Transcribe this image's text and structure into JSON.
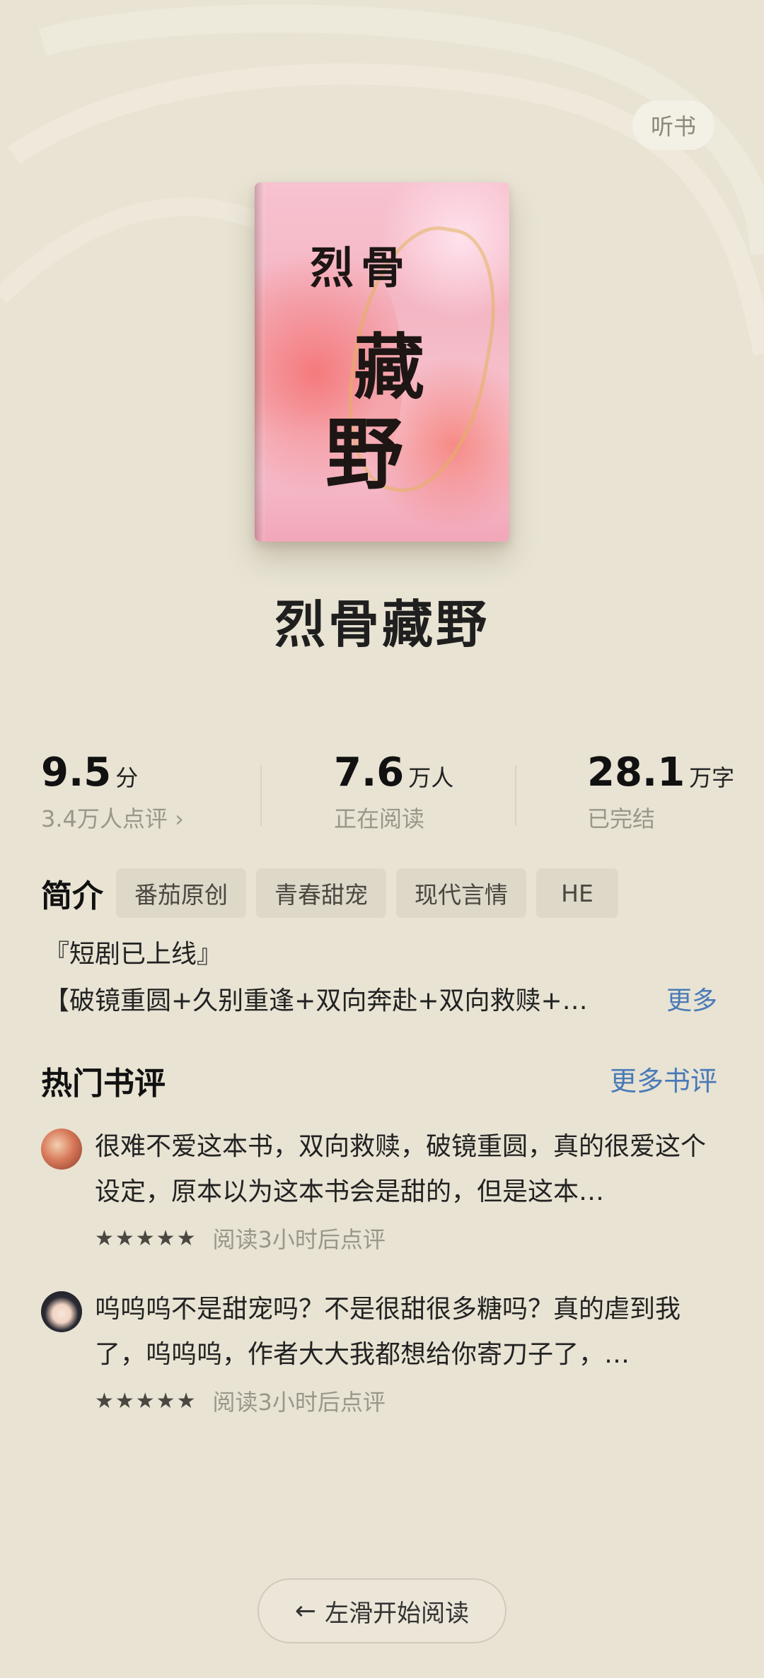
{
  "header": {
    "listen_label": "听书"
  },
  "book": {
    "cover_lines": [
      "烈",
      "骨",
      "藏",
      "野"
    ],
    "title": "烈骨藏野"
  },
  "stats": {
    "rating": {
      "value": "9.5",
      "unit": "分",
      "sub": "3.4万人点评 ›"
    },
    "readers": {
      "value": "7.6",
      "unit": "万人",
      "sub": "正在阅读"
    },
    "words": {
      "value": "28.1",
      "unit": "万字",
      "sub": "已完结"
    }
  },
  "intro": {
    "label": "简介",
    "tags": [
      "番茄原创",
      "青春甜宠",
      "现代言情",
      "HE"
    ],
    "line1": "『短剧已上线』",
    "line2": "【破镜重圆+久别重逢+双向奔赴+双向救赎+…",
    "more": "更多"
  },
  "reviews": {
    "title": "热门书评",
    "more": "更多书评",
    "items": [
      {
        "text": "很难不爱这本书，双向救赎，破镜重圆，真的很爱这个设定，原本以为这本书会是甜的，但是这本…",
        "stars": "★★★★★",
        "meta": "阅读3小时后点评"
      },
      {
        "text": "呜呜呜不是甜宠吗？不是很甜很多糖吗？真的虐到我了，呜呜呜，作者大大我都想给你寄刀子了，…",
        "stars": "★★★★★",
        "meta": "阅读3小时后点评"
      }
    ]
  },
  "footer": {
    "start_label": "左滑开始阅读",
    "arrow": "←"
  }
}
